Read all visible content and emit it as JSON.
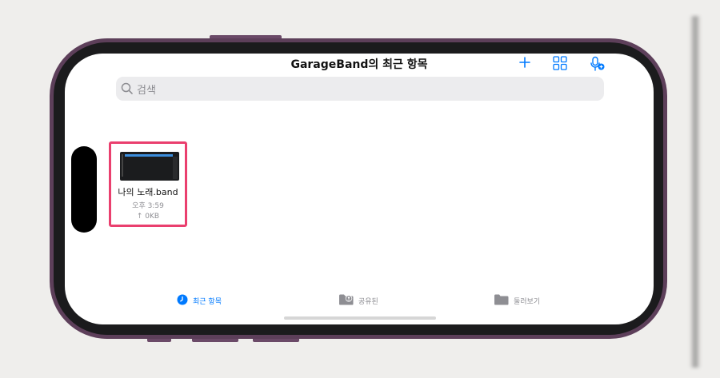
{
  "header": {
    "title": "GarageBand의 최근 항목",
    "add_icon": "plus-icon",
    "grid_icon": "grid-view-icon",
    "mic_icon": "microphone-add-icon"
  },
  "search": {
    "placeholder": "검색",
    "icon": "search-icon"
  },
  "files": [
    {
      "name": "나의 노래.band",
      "time": "오후 3:59",
      "size": "↑ 0KB"
    }
  ],
  "tabs": [
    {
      "label": "최근 항목",
      "icon": "clock-icon",
      "active": true
    },
    {
      "label": "공유된",
      "icon": "shared-folder-icon",
      "active": false
    },
    {
      "label": "둘러보기",
      "icon": "folder-icon",
      "active": false
    }
  ],
  "colors": {
    "accent": "#007aff",
    "highlight": "#ea3f6e",
    "frame": "#5d3f5a",
    "inactive_tab": "#8e8e93"
  }
}
